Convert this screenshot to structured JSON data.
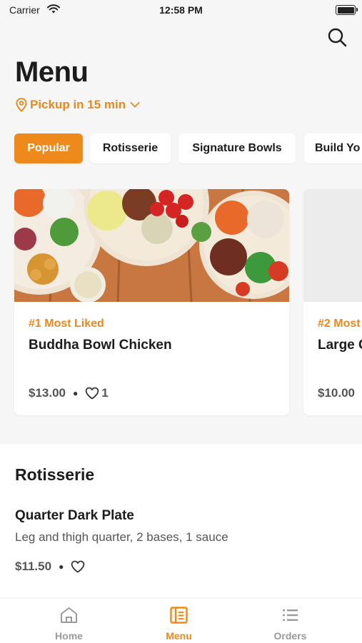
{
  "status_bar": {
    "carrier": "Carrier",
    "time": "12:58 PM"
  },
  "header": {
    "title": "Menu",
    "pickup": "Pickup in 15 min"
  },
  "categories": [
    "Popular",
    "Rotisserie",
    "Signature Bowls",
    "Build Yo"
  ],
  "featured": [
    {
      "tag": "#1 Most Liked",
      "name": "Buddha Bowl Chicken",
      "price": "$13.00",
      "likes": "1"
    },
    {
      "tag": "#2 Most",
      "name": "Large C",
      "price": "$10.00"
    }
  ],
  "section": {
    "title": "Rotisserie",
    "item": {
      "name": "Quarter Dark Plate",
      "description": "Leg and thigh quarter, 2 bases, 1 sauce",
      "price": "$11.50"
    }
  },
  "tabs": [
    {
      "label": "Home",
      "icon": "home-icon"
    },
    {
      "label": "Menu",
      "icon": "menu-book-icon"
    },
    {
      "label": "Orders",
      "icon": "list-icon"
    }
  ],
  "colors": {
    "accent": "#EE8A1C",
    "background": "#F6F6F6",
    "inactive_tab": "#9A9A9A"
  }
}
